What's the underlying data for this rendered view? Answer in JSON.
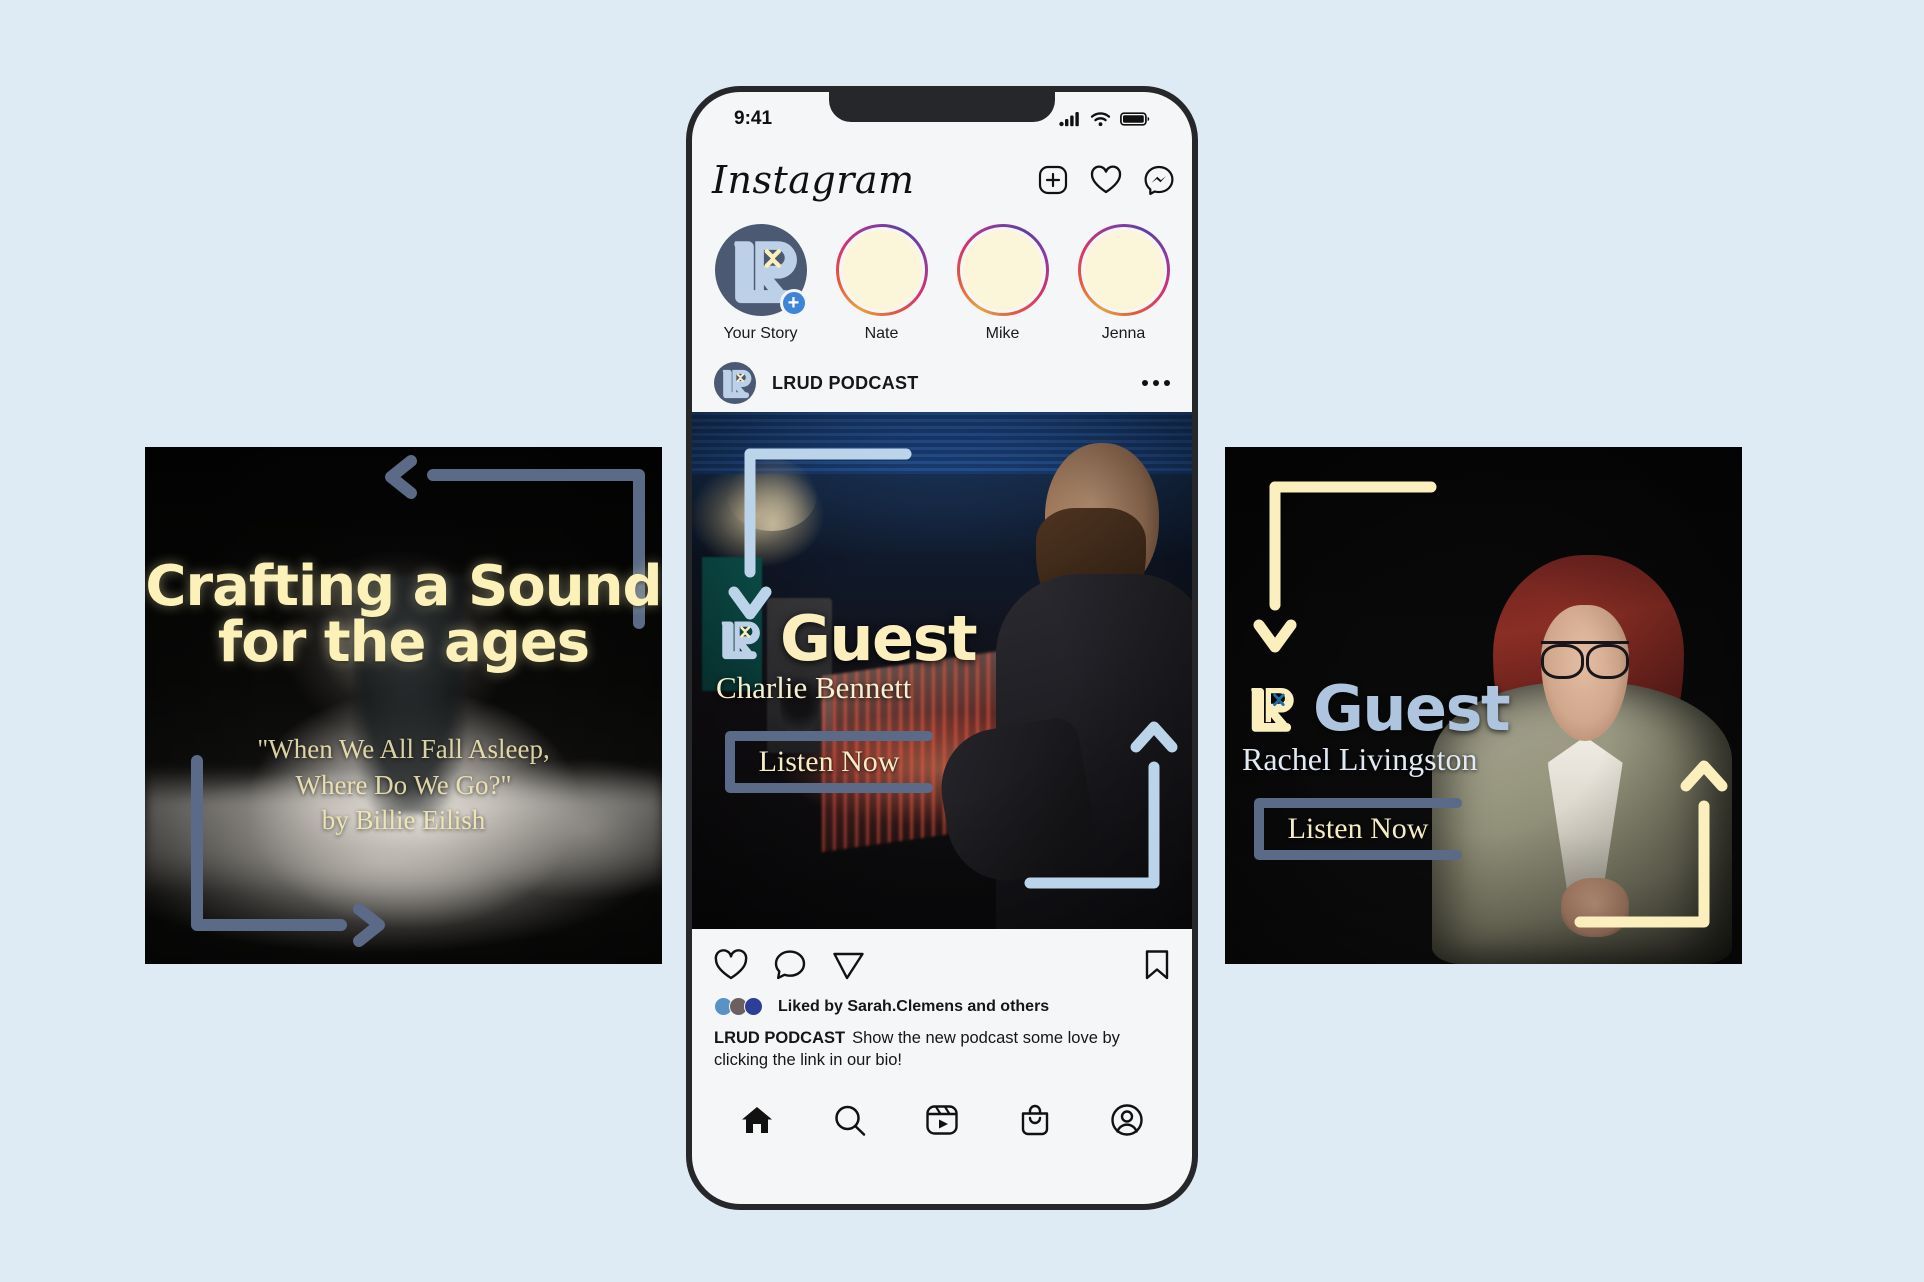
{
  "theme": {
    "page_background": "#deeaf4",
    "card_background": "#060606",
    "cream": "#fbf0bd",
    "slate_blue": "#5a6a87",
    "light_blue": "#aec4df",
    "brand_dark": "#4b5a72"
  },
  "phone": {
    "status_bar": {
      "time": "9:41",
      "icons": [
        "signal-bars-icon",
        "wifi-icon",
        "battery-icon"
      ]
    },
    "app_header": {
      "logo_text": "Instagram",
      "icons": [
        {
          "name": "add-post-icon",
          "label": "Add post"
        },
        {
          "name": "activity-heart-icon",
          "label": "Activity"
        },
        {
          "name": "messenger-icon",
          "label": "Messenger"
        }
      ]
    },
    "stories": [
      {
        "label": "Your Story",
        "type": "own",
        "has_add_badge": true,
        "avatar": "lrud-logo"
      },
      {
        "label": "Nate",
        "type": "unseen",
        "avatar": "cream"
      },
      {
        "label": "Mike",
        "type": "unseen",
        "avatar": "cream"
      },
      {
        "label": "Jenna",
        "type": "unseen",
        "avatar": "cream"
      }
    ],
    "post": {
      "account_name": "LRUD PODCAST",
      "menu_icon": "more-options-icon",
      "media": {
        "brand_mark": "lrud-logo",
        "heading": "Guest",
        "guest_name": "Charlie Bennett",
        "cta_label": "Listen Now",
        "heading_color": "#fbf0bd",
        "bracket_color": "#aec4df",
        "scene": "recording studio with mixing console"
      },
      "actions": [
        {
          "name": "like-icon",
          "label": "Like"
        },
        {
          "name": "comment-icon",
          "label": "Comment"
        },
        {
          "name": "share-icon",
          "label": "Share"
        },
        {
          "name": "save-bookmark-icon",
          "label": "Save"
        }
      ],
      "liked_by": "Liked by Sarah.Clemens and others",
      "liked_avatar_colors": [
        "#5a92c4",
        "#6b5f5f",
        "#2d3e96"
      ],
      "caption_author": "LRUD PODCAST",
      "caption_text": "Show the new podcast some love by clicking the link in our bio!"
    },
    "tab_bar": [
      {
        "name": "home-icon",
        "label": "Home",
        "active": true
      },
      {
        "name": "search-icon",
        "label": "Search",
        "active": false
      },
      {
        "name": "reels-icon",
        "label": "Reels",
        "active": false
      },
      {
        "name": "shop-bag-icon",
        "label": "Shop",
        "active": false
      },
      {
        "name": "profile-icon",
        "label": "Profile",
        "active": false
      }
    ]
  },
  "cards": {
    "left": {
      "title": "Crafting a Sound for the ages",
      "subtitle": "\"When We All Fall Asleep,\nWhere Do We Go?\"\nby Billie Eilish",
      "title_color": "#fbf1b9",
      "bracket_color": "#5a6a87",
      "scene": "artist seated on a white bed in a dark room"
    },
    "right": {
      "brand_mark": "lrud-logo",
      "heading": "Guest",
      "guest_name": "Rachel Livingston",
      "cta_label": "Listen Now",
      "heading_color": "#aec4df",
      "bracket_color": "#fbf0bd",
      "scene": "woman with red hair and glasses in a sage blazer"
    }
  }
}
